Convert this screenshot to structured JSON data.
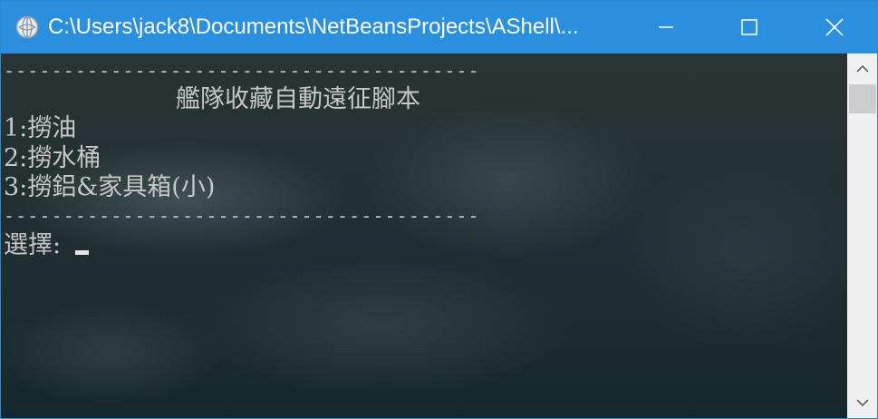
{
  "window": {
    "title": "C:\\Users\\jack8\\Documents\\NetBeansProjects\\AShell\\...",
    "accent_color": "#2b8fe0",
    "icons": {
      "app": "console-app-icon",
      "minimize": "minimize-icon",
      "maximize": "maximize-icon",
      "close": "close-icon"
    }
  },
  "console": {
    "divider_top": "----------------------------------------",
    "heading": "艦隊收藏自動遠征腳本",
    "options": [
      "1:撈油",
      "2:撈水桶",
      "3:撈鋁&家具箱(小)"
    ],
    "divider_bottom": "----------------------------------------",
    "prompt": "選擇:",
    "text_color": "#c7c7c7"
  },
  "scrollbar": {
    "icons": {
      "up": "scroll-up-arrow-icon",
      "down": "scroll-down-arrow-icon"
    }
  }
}
